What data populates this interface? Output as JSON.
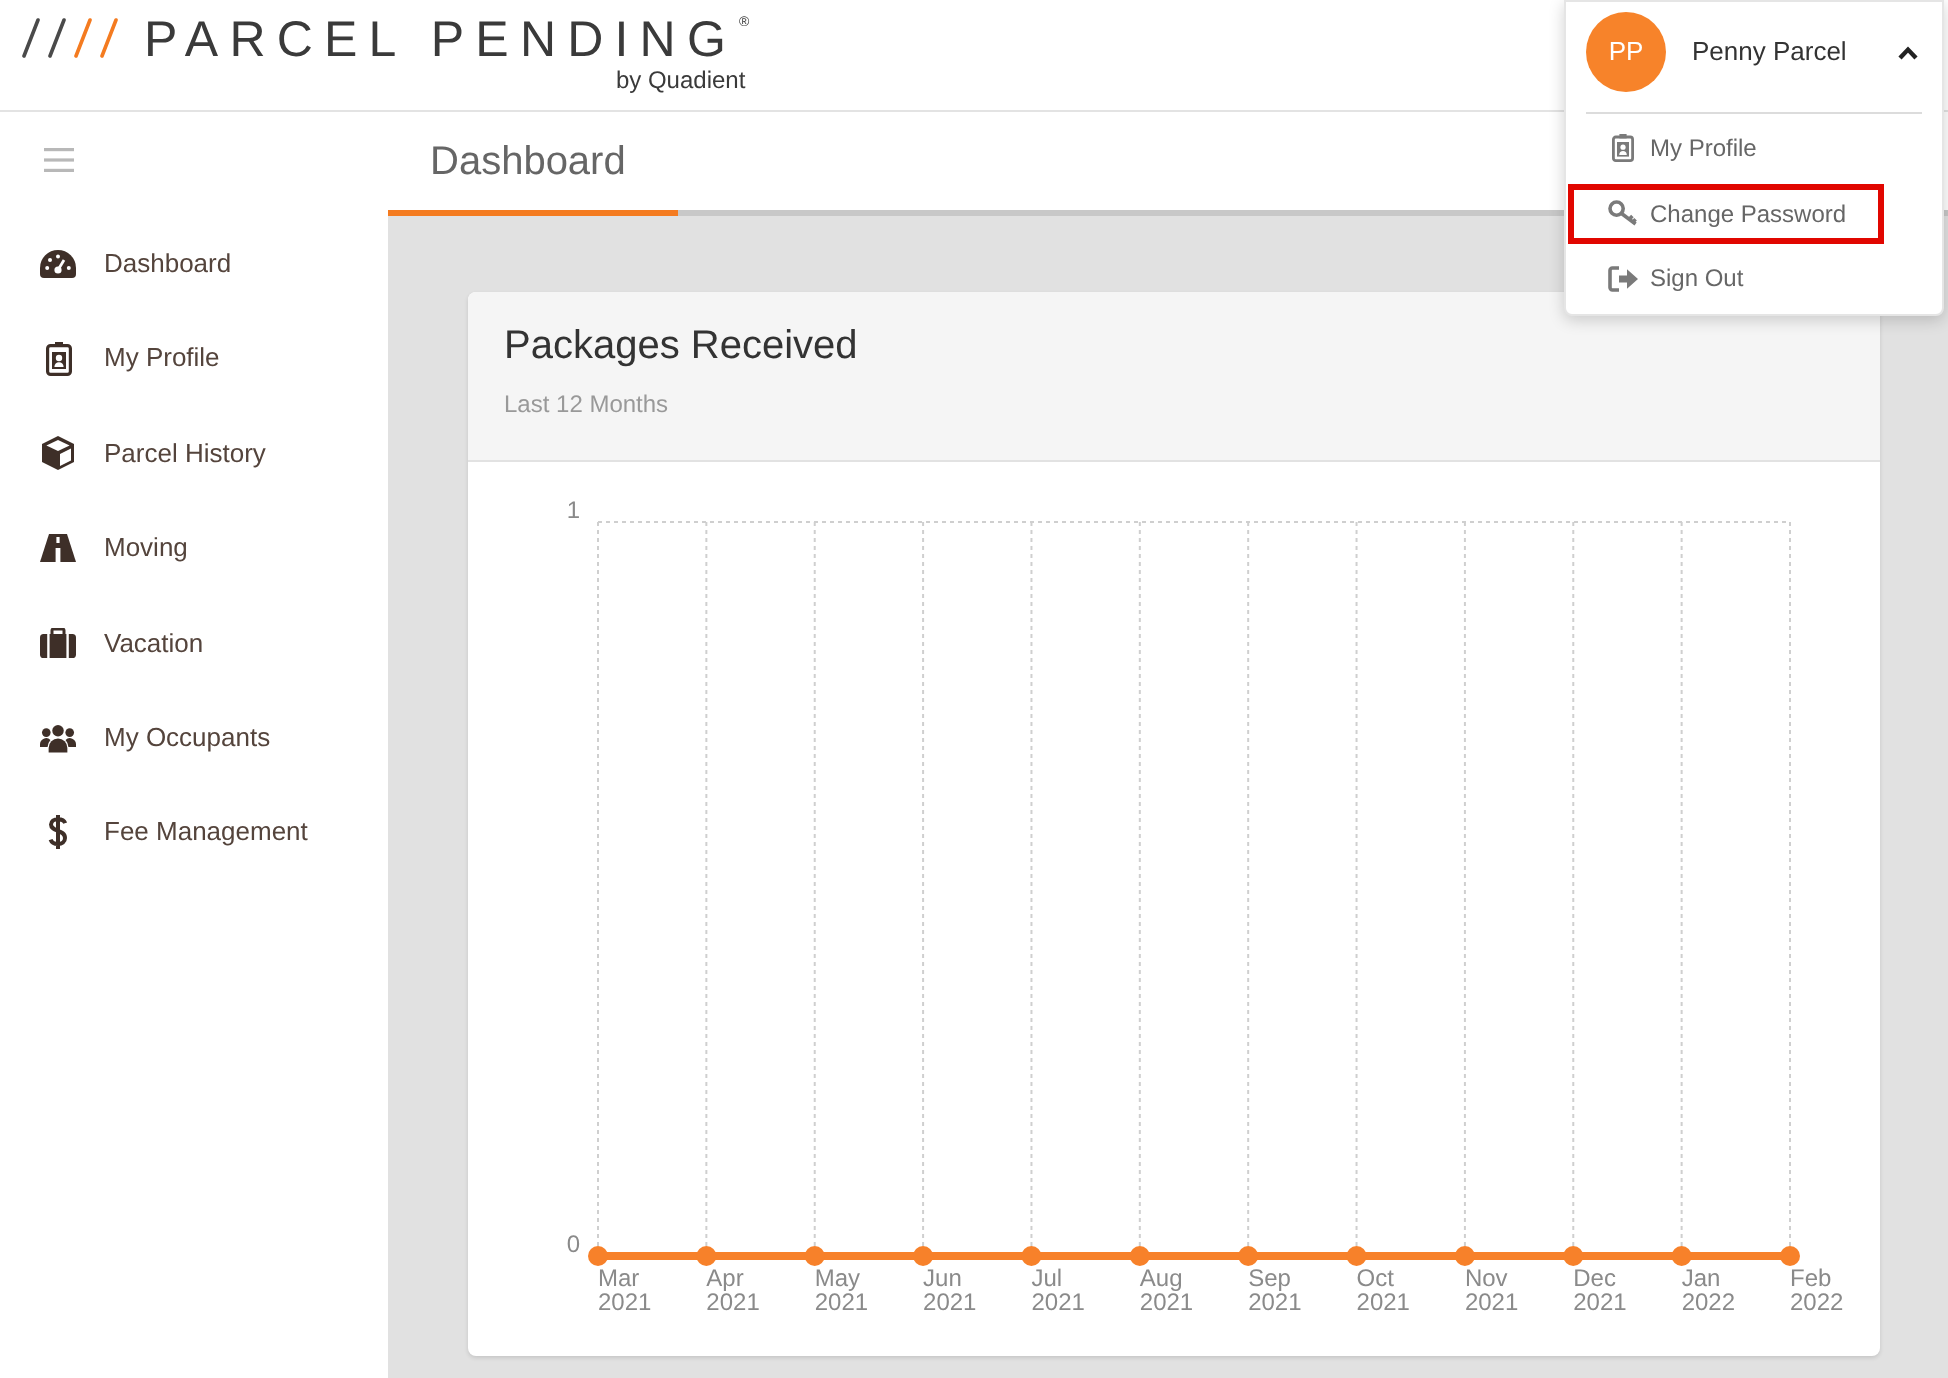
{
  "logo": {
    "wordmark": "PARCEL PENDING",
    "registered_mark": "®",
    "tagline": "by Quadient"
  },
  "sidebar": {
    "items": [
      {
        "label": "Dashboard"
      },
      {
        "label": "My Profile"
      },
      {
        "label": "Parcel History"
      },
      {
        "label": "Moving"
      },
      {
        "label": "Vacation"
      },
      {
        "label": "My Occupants"
      },
      {
        "label": "Fee Management"
      }
    ]
  },
  "tabs": [
    {
      "label": "Dashboard",
      "selected": true
    }
  ],
  "card": {
    "title": "Packages Received",
    "subtitle": "Last 12 Months",
    "chart_data": {
      "type": "line",
      "categories": [
        "Mar 2021",
        "Apr 2021",
        "May 2021",
        "Jun 2021",
        "Jul 2021",
        "Aug 2021",
        "Sep 2021",
        "Oct 2021",
        "Nov 2021",
        "Dec 2021",
        "Jan 2022",
        "Feb 2022"
      ],
      "series": [
        {
          "color": "#f7812a",
          "marker": "circle",
          "values": [
            0,
            0,
            0,
            0,
            0,
            0,
            0,
            0,
            0,
            0,
            0,
            0
          ]
        }
      ],
      "ylim": [
        0,
        1
      ],
      "yticks": [
        0,
        1
      ]
    }
  },
  "user_menu": {
    "avatar_initials": "PP",
    "user_name": "Penny Parcel",
    "expanded": true,
    "items": [
      {
        "label": "My Profile",
        "highlighted": false
      },
      {
        "label": "Change Password",
        "highlighted": true
      },
      {
        "label": "Sign Out",
        "highlighted": false
      }
    ]
  }
}
